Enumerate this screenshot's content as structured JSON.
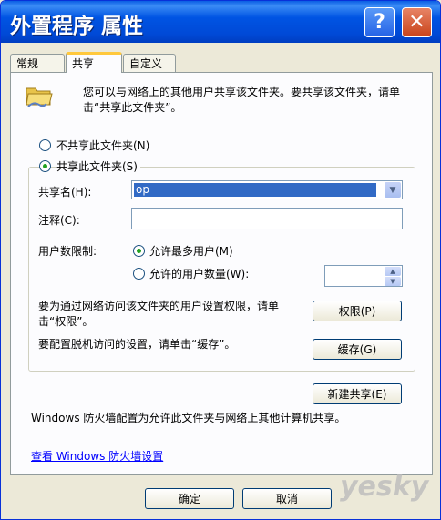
{
  "window": {
    "title": "外置程序 属性",
    "help_glyph": "?",
    "close_glyph": "✕"
  },
  "tabs": [
    {
      "label": "常规"
    },
    {
      "label": "共享"
    },
    {
      "label": "自定义"
    }
  ],
  "sharing": {
    "description": "您可以与网络上的其他用户共享该文件夹。要共享该文件夹，请单击“共享此文件夹”。",
    "radio_not_share": "不共享此文件夹(N)",
    "radio_share": "共享此文件夹(S)",
    "share_name_label": "共享名(H):",
    "share_name_value": "op",
    "comment_label": "注释(C):",
    "comment_value": "",
    "user_limit_label": "用户数限制:",
    "radio_max_users": "允许最多用户(M)",
    "radio_allowed_users": "允许的用户数量(W):",
    "permissions_text": "要为通过网络访问该文件夹的用户设置权限，请单击“权限”。",
    "permissions_button": "权限(P)",
    "cache_text": "要配置脱机访问的设置，请单击“缓存”。",
    "cache_button": "缓存(G)",
    "new_share_button": "新建共享(E)",
    "firewall_text": "Windows 防火墙配置为允许此文件夹与网络上其他计算机共享。",
    "firewall_link": "查看 Windows 防火墙设置"
  },
  "footer": {
    "ok": "确定",
    "cancel": "取消"
  },
  "watermark": "yesky",
  "colors": {
    "titlebar": "#0054e3",
    "tab_highlight": "#ffc83c",
    "selection": "#316ac5",
    "radio_dot": "#21a121"
  }
}
